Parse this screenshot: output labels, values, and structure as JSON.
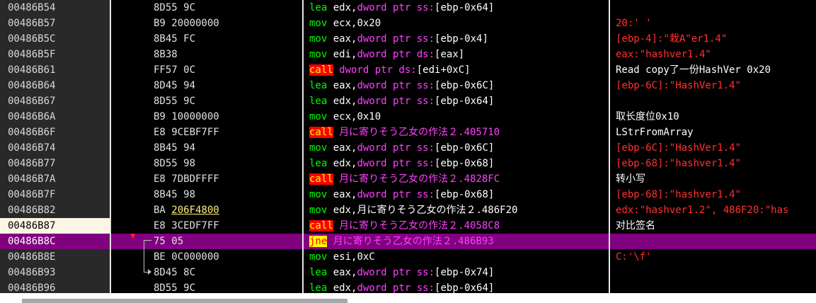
{
  "rows": [
    {
      "addr": "00486B54",
      "bytes": "8D55 9C",
      "mn": "lea",
      "mnc": "mn-g",
      "ops": [
        [
          "w",
          " edx,"
        ],
        [
          "m",
          "dword ptr ss:"
        ],
        [
          "w",
          "[ebp-0x64]"
        ]
      ],
      "cmt": "",
      "cc": "c-white"
    },
    {
      "addr": "00486B57",
      "bytes": "B9 20000000",
      "mn": "mov",
      "mnc": "mn-g",
      "ops": [
        [
          "w",
          " ecx,0x20"
        ]
      ],
      "cmt": "20:' '",
      "cc": "c-red"
    },
    {
      "addr": "00486B5C",
      "bytes": "8B45 FC",
      "mn": "mov",
      "mnc": "mn-g",
      "ops": [
        [
          "w",
          " eax,"
        ],
        [
          "m",
          "dword ptr ss:"
        ],
        [
          "w",
          "[ebp-0x4]"
        ]
      ],
      "cmt": "[ebp-4]:\"栽A\"er1.4\"",
      "cc": "c-red"
    },
    {
      "addr": "00486B5F",
      "bytes": "8B38",
      "mn": "mov",
      "mnc": "mn-g",
      "ops": [
        [
          "w",
          " edi,"
        ],
        [
          "m",
          "dword ptr ds:"
        ],
        [
          "w",
          "[eax]"
        ]
      ],
      "cmt": "eax:\"hashver1.4\"",
      "cc": "c-red"
    },
    {
      "addr": "00486B61",
      "bytes": "FF57 0C",
      "mn": "call",
      "mnc": "mn-call",
      "ops": [
        [
          "m",
          " dword ptr ds:"
        ],
        [
          "w",
          "[edi+0xC]"
        ]
      ],
      "cmt": "Read copy了一份HashVer 0x20",
      "cc": "c-white"
    },
    {
      "addr": "00486B64",
      "bytes": "8D45 94",
      "mn": "lea",
      "mnc": "mn-g",
      "ops": [
        [
          "w",
          " eax,"
        ],
        [
          "m",
          "dword ptr ss:"
        ],
        [
          "w",
          "[ebp-0x6C]"
        ]
      ],
      "cmt": "[ebp-6C]:\"HashVer1.4\"",
      "cc": "c-red"
    },
    {
      "addr": "00486B67",
      "bytes": "8D55 9C",
      "mn": "lea",
      "mnc": "mn-g",
      "ops": [
        [
          "w",
          " edx,"
        ],
        [
          "m",
          "dword ptr ss:"
        ],
        [
          "w",
          "[ebp-0x64]"
        ]
      ],
      "cmt": "",
      "cc": "c-white"
    },
    {
      "addr": "00486B6A",
      "bytes": "B9 10000000",
      "mn": "mov",
      "mnc": "mn-g",
      "ops": [
        [
          "w",
          " ecx,0x10"
        ]
      ],
      "cmt": "取长度位0x10",
      "cc": "c-white"
    },
    {
      "addr": "00486B6F",
      "bytes": "E8 9CEBF7FF",
      "mn": "call",
      "mnc": "mn-call",
      "ops": [
        [
          "m",
          " 月に寄りそう乙女の作法２.405710"
        ]
      ],
      "cmt": "LStrFromArray",
      "cc": "c-white"
    },
    {
      "addr": "00486B74",
      "bytes": "8B45 94",
      "mn": "mov",
      "mnc": "mn-g",
      "ops": [
        [
          "w",
          " eax,"
        ],
        [
          "m",
          "dword ptr ss:"
        ],
        [
          "w",
          "[ebp-0x6C]"
        ]
      ],
      "cmt": "[ebp-6C]:\"HashVer1.4\"",
      "cc": "c-red"
    },
    {
      "addr": "00486B77",
      "bytes": "8D55 98",
      "mn": "lea",
      "mnc": "mn-g",
      "ops": [
        [
          "w",
          " edx,"
        ],
        [
          "m",
          "dword ptr ss:"
        ],
        [
          "w",
          "[ebp-0x68]"
        ]
      ],
      "cmt": "[ebp-68]:\"hashver1.4\"",
      "cc": "c-red"
    },
    {
      "addr": "00486B7A",
      "bytes": "E8 7DBDFFFF",
      "mn": "call",
      "mnc": "mn-call",
      "ops": [
        [
          "m",
          " 月に寄りそう乙女の作法２.4828FC"
        ]
      ],
      "cmt": "转小写",
      "cc": "c-white"
    },
    {
      "addr": "00486B7F",
      "bytes": "8B45 98",
      "mn": "mov",
      "mnc": "mn-g",
      "ops": [
        [
          "w",
          " eax,"
        ],
        [
          "m",
          "dword ptr ss:"
        ],
        [
          "w",
          "[ebp-0x68]"
        ]
      ],
      "cmt": "[ebp-68]:\"hashver1.4\"",
      "cc": "c-red"
    },
    {
      "addr": "00486B82",
      "bytes": "BA ",
      "bytes_u": "206F4800",
      "mn": "mov",
      "mnc": "mn-g",
      "ops": [
        [
          "w",
          " edx,月に寄りそう乙女の作法２.486F20"
        ]
      ],
      "cmt": "edx:\"hashver1.2\", 486F20:\"has",
      "cc": "c-red"
    },
    {
      "addr": "00486B87",
      "bytes": "E8 3CEDF7FF",
      "mn": "call",
      "mnc": "mn-call",
      "ops": [
        [
          "m",
          " 月に寄りそう乙女の作法２.4058C8"
        ]
      ],
      "cmt": "对比签名",
      "cc": "c-white",
      "cur": true
    },
    {
      "addr": "00486B8C",
      "bytes": "75 05",
      "mn": "jne",
      "mnc": "mn-jne",
      "ops": [
        [
          "m",
          " 月に寄りそう乙女の作法２.486B93"
        ]
      ],
      "cmt": "",
      "cc": "c-white",
      "sel": true
    },
    {
      "addr": "00486B8E",
      "bytes": "BE 0C000000",
      "mn": "mov",
      "mnc": "mn-g",
      "ops": [
        [
          "w",
          " esi,0xC"
        ]
      ],
      "cmt": "C:'\\f'",
      "cc": "c-red"
    },
    {
      "addr": "00486B93",
      "bytes": "8D45 8C",
      "mn": "lea",
      "mnc": "mn-g",
      "ops": [
        [
          "w",
          " eax,"
        ],
        [
          "m",
          "dword ptr ss:"
        ],
        [
          "w",
          "[ebp-0x74]"
        ]
      ],
      "cmt": "",
      "cc": "c-white"
    },
    {
      "addr": "00486B96",
      "bytes": "8D55 9C",
      "mn": "lea",
      "mnc": "mn-g",
      "ops": [
        [
          "w",
          " edx,"
        ],
        [
          "m",
          "dword ptr ss:"
        ],
        [
          "w",
          "[ebp-0x64]"
        ]
      ],
      "cmt": "",
      "cc": "c-white"
    }
  ],
  "colors": {
    "selected_row": "#800080",
    "mnemonic": "#00ff00",
    "operand_mem": "#ff40ff",
    "call_bg": "#ff0000",
    "jne_bg": "#ffff00",
    "comment_red": "#ff3030"
  }
}
